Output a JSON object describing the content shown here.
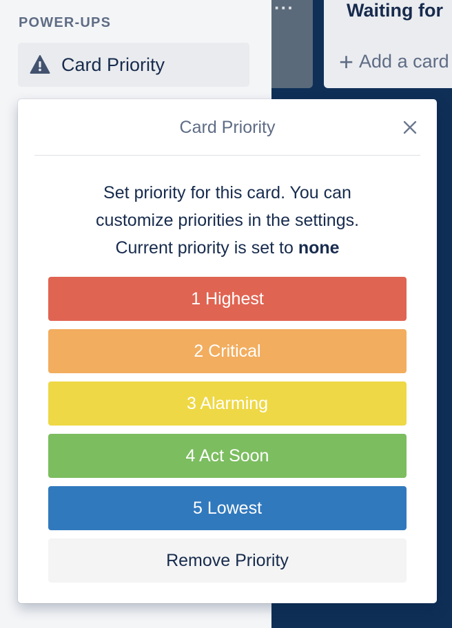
{
  "sidebar": {
    "section_title": "POWER-UPS",
    "powerup_button": {
      "label": "Card Priority",
      "icon": "warning-icon"
    }
  },
  "board": {
    "list_menu": "···",
    "list_waiting": {
      "title": "Waiting for",
      "add_card_label": "Add a card",
      "add_icon": "+"
    }
  },
  "popover": {
    "title": "Card Priority",
    "close_icon": "close-icon",
    "description_line1": "Set priority for this card. You can",
    "description_line2": "customize priorities in the settings.",
    "description_line3_prefix": "Current priority is set to",
    "current_priority": "none",
    "priorities": [
      {
        "label": "1 Highest",
        "color": "#e06452"
      },
      {
        "label": "2 Critical",
        "color": "#f2ad5e"
      },
      {
        "label": "3 Alarming",
        "color": "#eed845"
      },
      {
        "label": "4 Act Soon",
        "color": "#7bbd5f"
      },
      {
        "label": "5 Lowest",
        "color": "#3179bd"
      }
    ],
    "remove_button": {
      "label": "Remove Priority",
      "color": "#f4f4f4"
    }
  }
}
